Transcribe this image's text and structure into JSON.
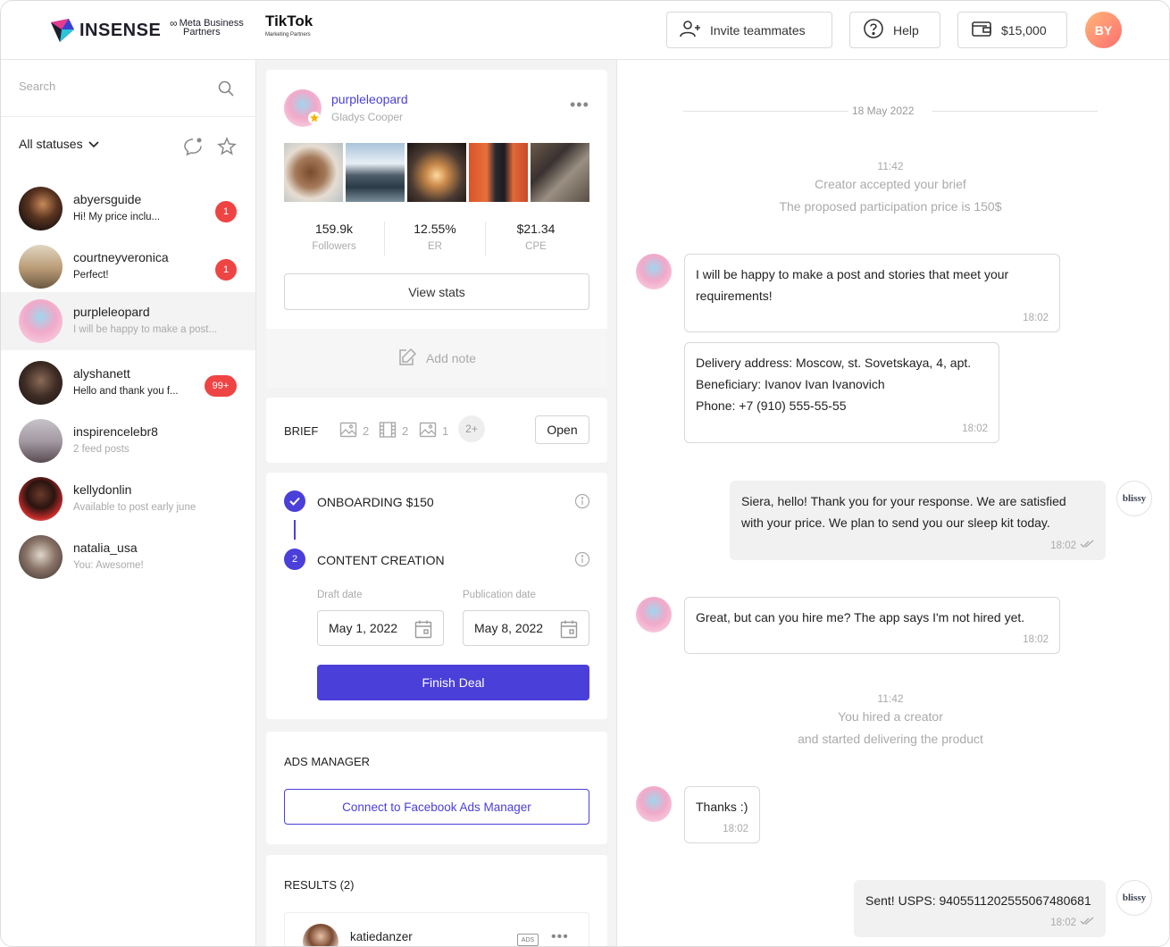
{
  "header": {
    "logo_text": "INSENSE",
    "meta_line1": "Meta Business",
    "meta_line2": "Partners",
    "tiktok_line1": "TikTok",
    "tiktok_line2": "Marketing Partners",
    "invite_label": "Invite teammates",
    "help_label": "Help",
    "balance": "$15,000",
    "user_initials": "BY"
  },
  "sidebar": {
    "search_placeholder": "Search",
    "status_filter": "All statuses",
    "contacts": [
      {
        "name": "abyersguide",
        "preview": "Hi! My price inclu...",
        "badge": "1"
      },
      {
        "name": "courtneyveronica",
        "preview": "Perfect!",
        "badge": "1"
      },
      {
        "name": "purpleleopard",
        "preview": "I will be happy to make a post...",
        "badge": ""
      },
      {
        "name": "alyshanett",
        "preview": "Hello and thank you f...",
        "badge": "99+"
      },
      {
        "name": "inspirencelebr8",
        "preview": "2 feed posts",
        "badge": ""
      },
      {
        "name": "kellydonlin",
        "preview": "Available to post early june",
        "badge": ""
      },
      {
        "name": "natalia_usa",
        "preview": "You: Awesome!",
        "badge": ""
      }
    ]
  },
  "profile": {
    "username": "purpleleopard",
    "full_name": "Gladys Cooper",
    "stats": [
      {
        "value": "159.9k",
        "label": "Followers"
      },
      {
        "value": "12.55%",
        "label": "ER"
      },
      {
        "value": "$21.34",
        "label": "CPE"
      }
    ],
    "view_stats_label": "View stats",
    "add_note_label": "Add note"
  },
  "brief": {
    "label": "BRIEF",
    "photo_count": "2",
    "video_count": "2",
    "story_count": "1",
    "more": "2+",
    "open_label": "Open"
  },
  "deal": {
    "step1_number": "",
    "step1_label": "ONBOARDING  $150",
    "step2_number": "2",
    "step2_label": "CONTENT CREATION",
    "draft_label": "Draft date",
    "draft_value": "May 1, 2022",
    "publication_label": "Publication date",
    "publication_value": "May 8, 2022",
    "finish_label": "Finish Deal"
  },
  "ads": {
    "label": "ADS MANAGER",
    "connect_label": "Connect to Facebook Ads Manager"
  },
  "results": {
    "label": "RESULTS (2)",
    "first_name": "katiedanzer",
    "ads_tag": "ADS"
  },
  "chat": {
    "date": "18 May 2022",
    "sys1_time": "11:42",
    "sys1_line1": "Creator accepted your brief",
    "sys1_line2": "The proposed participation price is 150$",
    "m1_text_line1": "I will be happy to make a post and stories that meet your",
    "m1_text_line2": "requirements!",
    "m1_time": "18:02",
    "m2_line1": "Delivery address: Moscow, st. Sovetskaya, 4, apt.",
    "m2_line2": "Beneficiary: Ivanov Ivan Ivanovich",
    "m2_line3": "Phone: +7 (910) 555-55-55",
    "m2_time": "18:02",
    "m3_line1": "Siera, hello! Thank you for your response. We are satisfied",
    "m3_line2": "with your price. We plan to send you our sleep kit today.",
    "m3_time": "18:02",
    "m4_text": "Great, but can you hire me? The app says I'm not hired yet.",
    "m4_time": "18:02",
    "sys2_time": "11:42",
    "sys2_line1": "You hired a creator",
    "sys2_line2": "and started delivering the product",
    "m5_text": "Thanks :)",
    "m5_time": "18:02",
    "m6_text": "Sent! USPS: 9405511202555067480681",
    "m6_time": "18:02",
    "brand_name": "blissy"
  },
  "colors": {
    "accent": "#4a3fd9",
    "badge": "#ef4444",
    "avatar_gradient_start": "#ffb77a",
    "avatar_gradient_end": "#ff6e6e"
  }
}
